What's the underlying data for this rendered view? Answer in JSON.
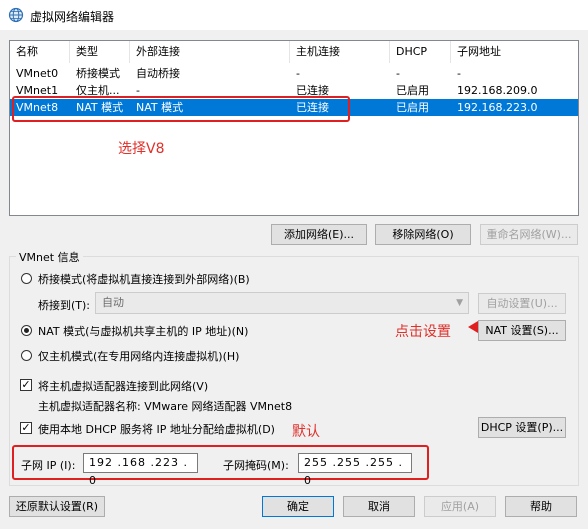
{
  "window": {
    "title": "虚拟网络编辑器"
  },
  "list": {
    "headers": [
      "名称",
      "类型",
      "外部连接",
      "主机连接",
      "DHCP",
      "子网地址"
    ],
    "rows": [
      [
        "VMnet0",
        "桥接模式",
        "自动桥接",
        "-",
        "-",
        "-"
      ],
      [
        "VMnet1",
        "仅主机...",
        "-",
        "已连接",
        "已启用",
        "192.168.209.0"
      ],
      [
        "VMnet8",
        "NAT 模式",
        "NAT 模式",
        "已连接",
        "已启用",
        "192.168.223.0"
      ]
    ],
    "selected_row": 2
  },
  "list_buttons": {
    "add": "添加网络(E)...",
    "remove": "移除网络(O)",
    "rename": "重命名网络(W)..."
  },
  "vmnet_info": {
    "group_label": "VMnet 信息",
    "bridged_radio": "桥接模式(将虚拟机直接连接到外部网络)(B)",
    "bridge_to_label": "桥接到(T):",
    "bridge_to_value": "自动",
    "auto_settings": "自动设置(U)...",
    "nat_radio": "NAT 模式(与虚拟机共享主机的 IP 地址)(N)",
    "nat_settings": "NAT 设置(S)...",
    "hostonly_radio": "仅主机模式(在专用网络内连接虚拟机)(H)",
    "connect_adapter_check": "将主机虚拟适配器连接到此网络(V)",
    "adapter_name": "主机虚拟适配器名称: VMware 网络适配器 VMnet8",
    "dhcp_check": "使用本地 DHCP 服务将 IP 地址分配给虚拟机(D)",
    "dhcp_settings": "DHCP 设置(P)...",
    "subnet_ip_label": "子网 IP (I):",
    "subnet_ip_value": "192 .168 .223 . 0",
    "subnet_mask_label": "子网掩码(M):",
    "subnet_mask_value": "255 .255 .255 . 0"
  },
  "footer": {
    "restore": "还原默认设置(R)",
    "ok": "确定",
    "cancel": "取消",
    "apply": "应用(A)",
    "help": "帮助"
  },
  "annotations": {
    "select_v8": "选择V8",
    "click_settings": "点击设置",
    "default": "默认"
  },
  "colors": {
    "selection": "#0078d7",
    "annotation": "#e0302a"
  }
}
